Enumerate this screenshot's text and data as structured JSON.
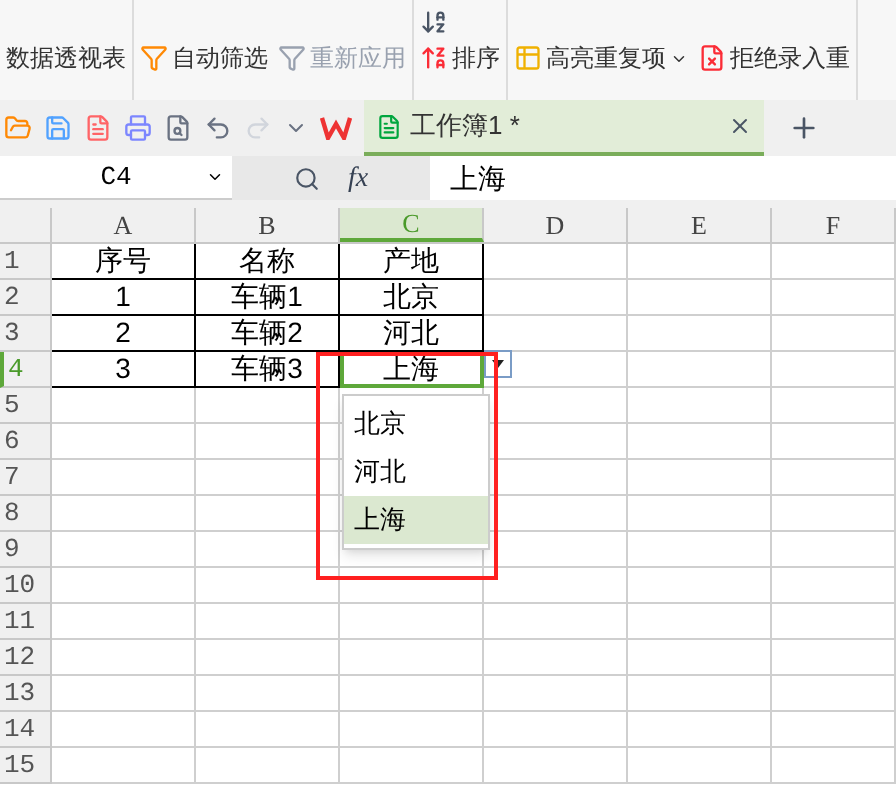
{
  "ribbon": {
    "groups": [
      {
        "buttons": [
          {
            "label": "数据透视表",
            "disabled": false
          }
        ]
      },
      {
        "buttons": [
          {
            "label": "自动筛选",
            "disabled": false
          },
          {
            "label": "重新应用",
            "disabled": true
          }
        ]
      },
      {
        "buttons": [
          {
            "label": "排序",
            "disabled": false
          }
        ]
      },
      {
        "buttons": [
          {
            "label": "高亮重复项",
            "disabled": false,
            "dropdown": true
          },
          {
            "label": "拒绝录入重",
            "disabled": false,
            "dropdown": false
          }
        ]
      }
    ]
  },
  "tab": {
    "title": "工作簿1 *",
    "selected": true
  },
  "formula_bar": {
    "cell_ref": "C4",
    "fx": "fx",
    "value": "上海"
  },
  "sheet": {
    "columns": [
      {
        "label": "A",
        "selected": false
      },
      {
        "label": "B",
        "selected": false
      },
      {
        "label": "C",
        "selected": true
      },
      {
        "label": "D",
        "selected": false
      },
      {
        "label": "E",
        "selected": false
      },
      {
        "label": "F",
        "selected": false
      }
    ],
    "rows": [
      {
        "label": "1",
        "selected": false,
        "cells": [
          "序号",
          "名称",
          "产地"
        ]
      },
      {
        "label": "2",
        "selected": false,
        "cells": [
          "1",
          "车辆1",
          "北京"
        ]
      },
      {
        "label": "3",
        "selected": false,
        "cells": [
          "2",
          "车辆2",
          "河北"
        ]
      },
      {
        "label": "4",
        "selected": true,
        "cells": [
          "3",
          "车辆3",
          "上海"
        ]
      },
      {
        "label": "5",
        "selected": false,
        "cells": []
      },
      {
        "label": "6",
        "selected": false,
        "cells": []
      },
      {
        "label": "7",
        "selected": false,
        "cells": []
      },
      {
        "label": "8",
        "selected": false,
        "cells": []
      },
      {
        "label": "9",
        "selected": false,
        "cells": []
      },
      {
        "label": "10",
        "selected": false,
        "cells": []
      },
      {
        "label": "11",
        "selected": false,
        "cells": []
      },
      {
        "label": "12",
        "selected": false,
        "cells": []
      },
      {
        "label": "13",
        "selected": false,
        "cells": []
      },
      {
        "label": "14",
        "selected": false,
        "cells": []
      },
      {
        "label": "15",
        "selected": false,
        "cells": []
      }
    ],
    "dropdown": {
      "items": [
        {
          "label": "北京",
          "selected": false
        },
        {
          "label": "河北",
          "selected": false
        },
        {
          "label": "上海",
          "selected": true
        }
      ]
    },
    "highlight_box": true
  }
}
